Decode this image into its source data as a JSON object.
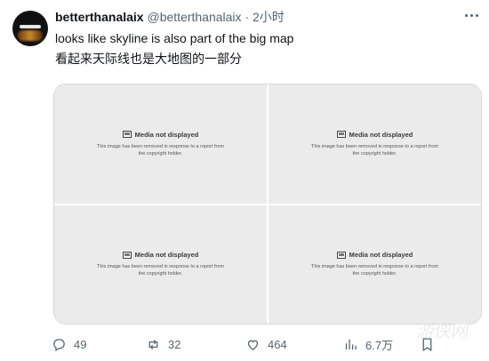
{
  "tweet": {
    "display_name": "betterthanalaix",
    "handle": "@betterthanalaix",
    "separator": "·",
    "time": "2小时",
    "text_en": "looks like skyline is also part of the big map",
    "text_cn": "看起来天际线也是大地图的一部分"
  },
  "media": {
    "items": [
      {
        "title": "Media not displayed",
        "description": "This image has been removed in response to a report from the copyright holder."
      },
      {
        "title": "Media not displayed",
        "description": "This image has been removed in response to a report from the copyright holder."
      },
      {
        "title": "Media not displayed",
        "description": "This image has been removed in response to a report from the copyright holder."
      },
      {
        "title": "Media not displayed",
        "description": "This image has been removed in response to a report from the copyright holder."
      }
    ]
  },
  "actions": {
    "replies": "49",
    "reposts": "32",
    "likes": "464",
    "views": "6.7万"
  },
  "watermark": "游侠网",
  "icons": [
    "more-options-icon",
    "media-warning-icon",
    "reply-icon",
    "repost-icon",
    "like-icon",
    "views-icon",
    "bookmark-icon",
    "share-icon"
  ],
  "colors": {
    "text": "#0f1419",
    "secondary": "#536471",
    "media_bg": "#ebebeb",
    "border": "#cfd9de"
  }
}
